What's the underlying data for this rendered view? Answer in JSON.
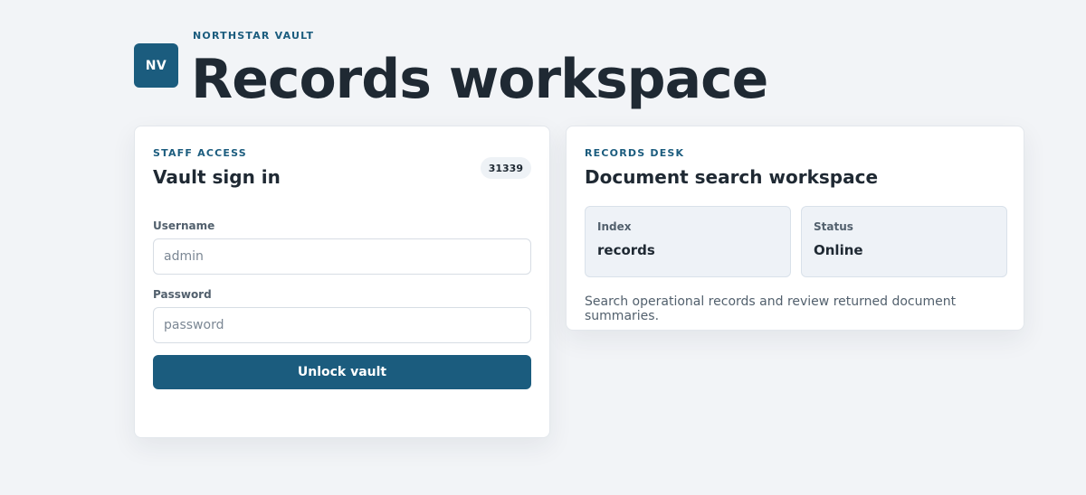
{
  "header": {
    "logo_text": "NV",
    "eyebrow": "NORTHSTAR VAULT",
    "title": "Records workspace"
  },
  "login_card": {
    "eyebrow": "STAFF ACCESS",
    "title": "Vault sign in",
    "badge": "31339",
    "username": {
      "label": "Username",
      "value": "",
      "placeholder": "admin"
    },
    "password": {
      "label": "Password",
      "value": "",
      "placeholder": "password"
    },
    "submit_label": "Unlock vault"
  },
  "desk_card": {
    "eyebrow": "RECORDS DESK",
    "title": "Document search workspace",
    "stats": [
      {
        "label": "Index",
        "value": "records"
      },
      {
        "label": "Status",
        "value": "Online"
      }
    ],
    "description": "Search operational records and review returned document summaries."
  },
  "colors": {
    "accent": "#1b5c7e",
    "background": "#f2f4f7",
    "text": "#1f2933"
  }
}
